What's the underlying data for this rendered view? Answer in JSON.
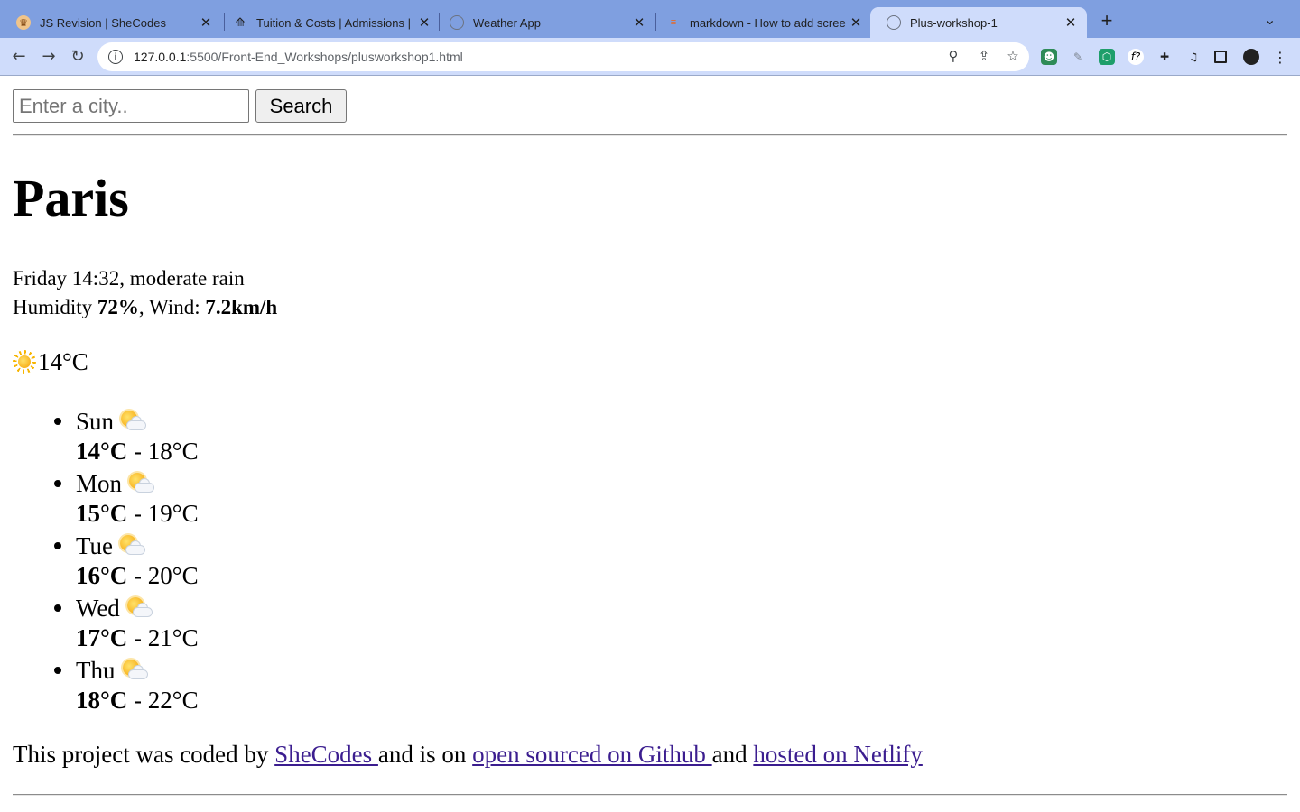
{
  "browser": {
    "tabs": [
      {
        "title": "JS Revision | SheCodes",
        "active": false
      },
      {
        "title": "Tuition & Costs | Admissions |",
        "active": false
      },
      {
        "title": "Weather App",
        "active": false
      },
      {
        "title": "markdown - How to add scree",
        "active": false
      },
      {
        "title": "Plus-workshop-1",
        "active": true
      }
    ],
    "new_tab_label": "+",
    "address": {
      "host": "127.0.0.1",
      "path": ":5500/Front-End_Workshops/plusworkshop1.html"
    },
    "colors": {
      "tabbar": "#7f9fe0",
      "toolbar": "#cfdcfb"
    }
  },
  "search": {
    "placeholder": "Enter a city..",
    "value": "",
    "button_label": "Search"
  },
  "weather": {
    "city": "Paris",
    "day_time": "Friday 14:32",
    "condition": "moderate rain",
    "humidity_label": "Humidity",
    "humidity_value": "72%",
    "wind_label": "Wind:",
    "wind_value": "7.2km/h",
    "current_icon": "sun-icon",
    "current_temp": "14°C"
  },
  "forecast": [
    {
      "day": "Sun",
      "icon": "partly-cloudy-icon",
      "min": "14°C",
      "max": "18°C"
    },
    {
      "day": "Mon",
      "icon": "partly-cloudy-icon",
      "min": "15°C",
      "max": "19°C"
    },
    {
      "day": "Tue",
      "icon": "partly-cloudy-icon",
      "min": "16°C",
      "max": "20°C"
    },
    {
      "day": "Wed",
      "icon": "partly-cloudy-icon",
      "min": "17°C",
      "max": "21°C"
    },
    {
      "day": "Thu",
      "icon": "partly-cloudy-icon",
      "min": "18°C",
      "max": "22°C"
    }
  ],
  "footer": {
    "text_1": "This project was coded by ",
    "link_1": "SheCodes ",
    "text_2": "and is on ",
    "link_2": "open sourced on Github ",
    "text_3": "and ",
    "link_3": "hosted on Netlify",
    "link_color": "#3b1d8f"
  }
}
